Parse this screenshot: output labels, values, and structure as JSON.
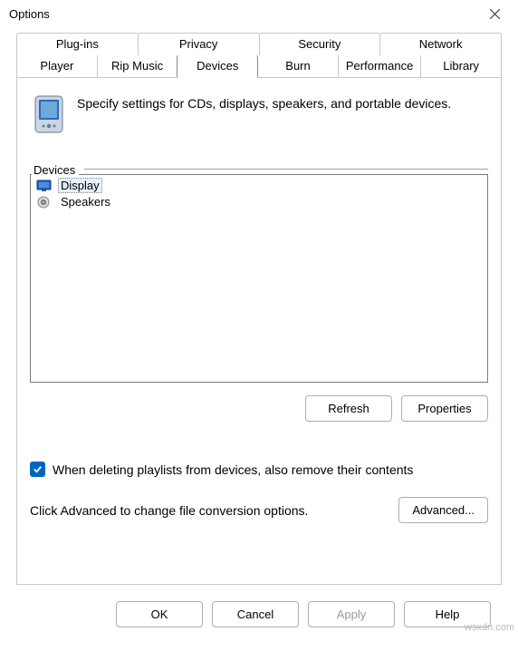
{
  "window": {
    "title": "Options"
  },
  "tabs": {
    "row1": [
      "Plug-ins",
      "Privacy",
      "Security",
      "Network"
    ],
    "row2": [
      "Player",
      "Rip Music",
      "Devices",
      "Burn",
      "Performance",
      "Library"
    ],
    "active": "Devices"
  },
  "header": {
    "description": "Specify settings for CDs, displays, speakers, and portable devices."
  },
  "devices": {
    "group_label": "Devices",
    "items": [
      {
        "label": "Display",
        "icon": "monitor",
        "selected": true
      },
      {
        "label": "Speakers",
        "icon": "speaker",
        "selected": false
      }
    ],
    "refresh_label": "Refresh",
    "properties_label": "Properties"
  },
  "checkbox": {
    "checked": true,
    "label": "When deleting playlists from devices, also remove their contents"
  },
  "advanced": {
    "text": "Click Advanced to change file conversion options.",
    "button_label": "Advanced..."
  },
  "footer": {
    "ok": "OK",
    "cancel": "Cancel",
    "apply": "Apply",
    "help": "Help"
  },
  "watermark": "wsxdn.com"
}
